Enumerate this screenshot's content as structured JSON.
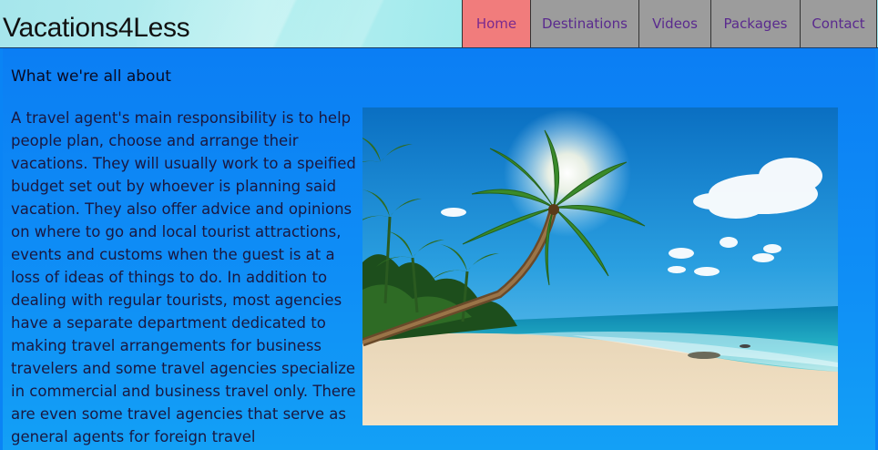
{
  "site": {
    "title": "Vacations4Less"
  },
  "nav": {
    "items": [
      {
        "label": "Home",
        "active": true
      },
      {
        "label": "Destinations",
        "active": false
      },
      {
        "label": "Videos",
        "active": false
      },
      {
        "label": "Packages",
        "active": false
      },
      {
        "label": "Contact",
        "active": false
      }
    ]
  },
  "main": {
    "heading": "What we're all about",
    "paragraph": "A travel agent's main responsibility is to help people plan, choose and arrange their vacations. They will usually work to a speified budget set out by whoever is planning said vacation. They also offer advice and opinions on where to go and local tourist attractions, events and customs when the guest is at a loss of ideas of things to do. In addition to dealing with regular tourists, most agencies have a separate department dedicated to making travel arrangements for business travelers and some travel agencies specialize in commercial and business travel only. There are even some travel agencies that serve as general agents for foreign travel"
  },
  "colors": {
    "page_background": "#0a84f5",
    "nav_active": "#f17c7c",
    "nav_inactive": "#9c9c9c",
    "nav_text": "#5a2a8e"
  }
}
